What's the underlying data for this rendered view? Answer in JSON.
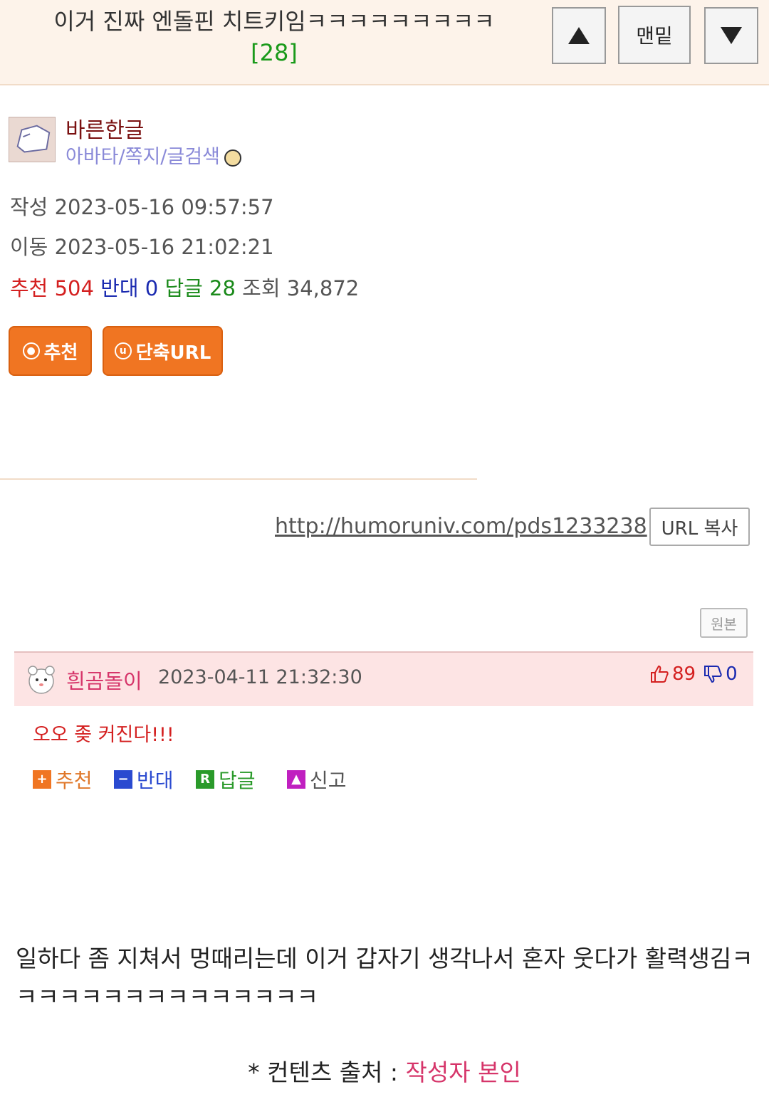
{
  "header": {
    "title": "이거 진짜 엔돌핀 치트키임ㅋㅋㅋㅋㅋㅋㅋㅋㅋ",
    "reply_count": "[28]",
    "bottom_label": "맨밑"
  },
  "author": {
    "nickname": "바른한글",
    "links": "아바타/쪽지/글검색"
  },
  "meta": {
    "created": "작성 2023-05-16 09:57:57",
    "moved": "이동 2023-05-16 21:02:21"
  },
  "stats": {
    "recommend_label": "추천",
    "recommend": "504",
    "oppose_label": "반대",
    "oppose": "0",
    "reply_label": "답글",
    "reply": "28",
    "view_label": "조회",
    "view": "34,872"
  },
  "buttons": {
    "recommend": "추천",
    "short_url": "단축URL"
  },
  "url": {
    "link": "http://humoruniv.com/pds1233238",
    "copy": "URL 복사"
  },
  "original_label": "원본",
  "comment": {
    "nickname": "흰곰돌이",
    "date": "2023-04-11 21:32:30",
    "up": "89",
    "down": "0",
    "text": "오오 좆 커진다!!!",
    "actions": {
      "recommend": "추천",
      "oppose": "반대",
      "reply": "답글",
      "report": "신고"
    }
  },
  "body": {
    "text": "일하다 좀 지쳐서 멍때리는데 이거 갑자기 생각나서 혼자 웃다가 활력생김ㅋㅋㅋㅋㅋㅋㅋㅋㅋㅋㅋㅋㅋㅋㅋ"
  },
  "source": {
    "label": "* 컨텐츠 출처 :",
    "who": "작성자 본인"
  },
  "colors": {
    "header_bg": "#fdf3ea",
    "accent_orange": "#f07522",
    "recommend_red": "#d42020",
    "oppose_blue": "#1a2ab0",
    "reply_green": "#1a8a1a",
    "comment_bg": "#fde4e4",
    "nick_pink": "#d6356a"
  }
}
